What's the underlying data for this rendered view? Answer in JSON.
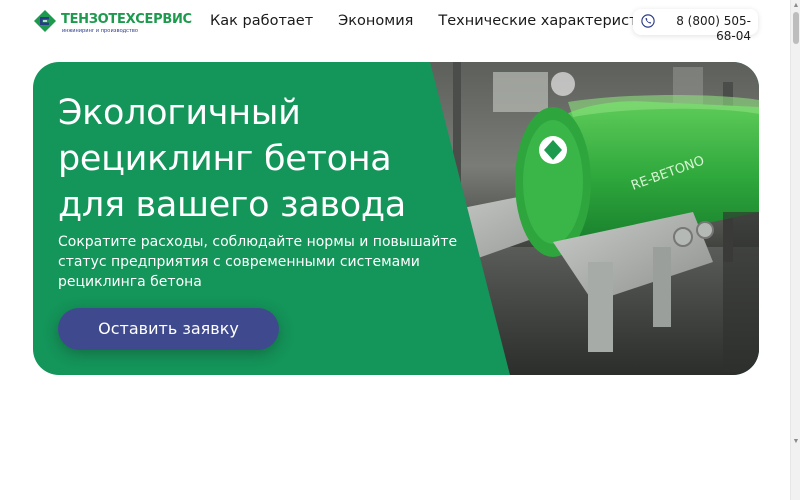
{
  "header": {
    "logo_name": "ТЕНЗОТЕХСЕРВИС",
    "logo_tagline": "инжиниринг и производство",
    "nav": [
      {
        "label": "Как работает"
      },
      {
        "label": "Экономия"
      },
      {
        "label": "Технические характеристики"
      }
    ],
    "phone": "8 (800) 505-68-04"
  },
  "hero": {
    "title_lines": [
      "Экологичный",
      "рециклинг бетона",
      "для вашего завода"
    ],
    "subtitle": "Сократите расходы, соблюдайте нормы и повышайте статус предприятия с современными системами рециклинга бетона",
    "cta_label": "Оставить заявку",
    "machine_text": "RE-BETONO"
  },
  "colors": {
    "brand_green": "#14955a",
    "cta_blue": "#3f4a8e",
    "logo_blue": "#2b3b8a"
  },
  "icons": [
    "logo-mark-icon",
    "phone-icon",
    "scroll-up-icon",
    "scroll-down-icon"
  ]
}
